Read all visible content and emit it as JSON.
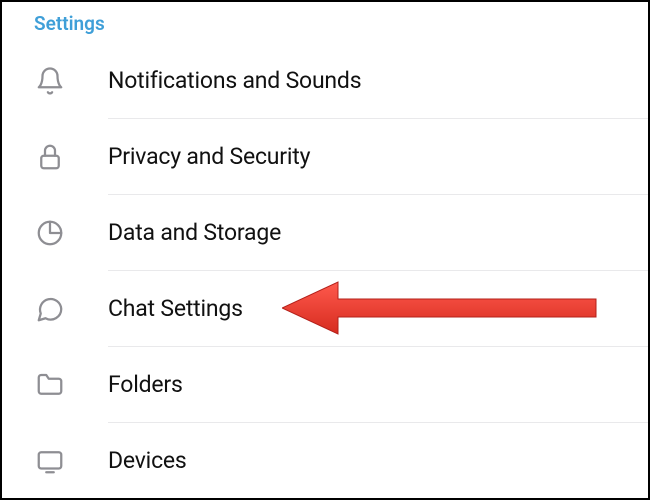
{
  "header": {
    "title": "Settings"
  },
  "items": [
    {
      "label": "Notifications and Sounds",
      "icon": "bell-icon"
    },
    {
      "label": "Privacy and Security",
      "icon": "lock-icon"
    },
    {
      "label": "Data and Storage",
      "icon": "pie-chart-icon"
    },
    {
      "label": "Chat Settings",
      "icon": "speech-bubble-icon"
    },
    {
      "label": "Folders",
      "icon": "folder-icon"
    },
    {
      "label": "Devices",
      "icon": "device-icon"
    }
  ],
  "annotation": {
    "type": "arrow",
    "target_index": 3,
    "color": "#ff3b30"
  }
}
